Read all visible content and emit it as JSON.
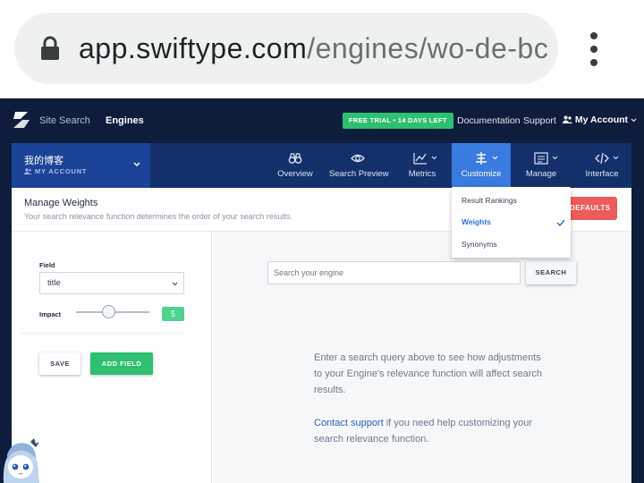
{
  "browser": {
    "url_host": "app.swiftype.com",
    "url_path": "/engines/wo-de-bc"
  },
  "topnav": {
    "brand": "Site Search",
    "engines": "Engines",
    "trial_badge": "FREE TRIAL • 14 DAYS LEFT",
    "documentation": "Documentation",
    "support": "Support",
    "account": "My Account"
  },
  "engine": {
    "name": "我的博客",
    "sub": "MY ACCOUNT"
  },
  "tabs": [
    {
      "label": "Overview",
      "icon": "binoculars-icon"
    },
    {
      "label": "Search Preview",
      "icon": "eye-icon"
    },
    {
      "label": "Metrics",
      "icon": "chart-line-icon"
    },
    {
      "label": "Customize",
      "icon": "sliders-icon"
    },
    {
      "label": "Manage",
      "icon": "list-icon"
    },
    {
      "label": "Interface",
      "icon": "code-icon"
    }
  ],
  "page": {
    "title": "Manage Weights",
    "subtitle": "Your search relevance function determines the order of your search results.",
    "defaults_button": "DEFAULTS"
  },
  "weights": {
    "field_label": "Field",
    "field_value": "title",
    "impact_label": "Impact",
    "impact_value": "5",
    "impact_level": 5,
    "save": "SAVE",
    "add_field": "ADD FIELD"
  },
  "preview": {
    "search_placeholder": "Search your engine",
    "search_button": "SEARCH",
    "help_text": "Enter a search query above to see how adjustments to your Engine's relevance function will affect search results.",
    "contact_link": "Contact support",
    "contact_rest": " if you need help customizing your search relevance function."
  },
  "dropdown": {
    "items": [
      "Result Rankings",
      "Weights",
      "Synonyms"
    ],
    "selected": "Weights"
  },
  "colors": {
    "nav_bg": "#0e1d3c",
    "active_tab": "#3a7be0",
    "green": "#2fbf71",
    "red": "#ef5a5a"
  }
}
